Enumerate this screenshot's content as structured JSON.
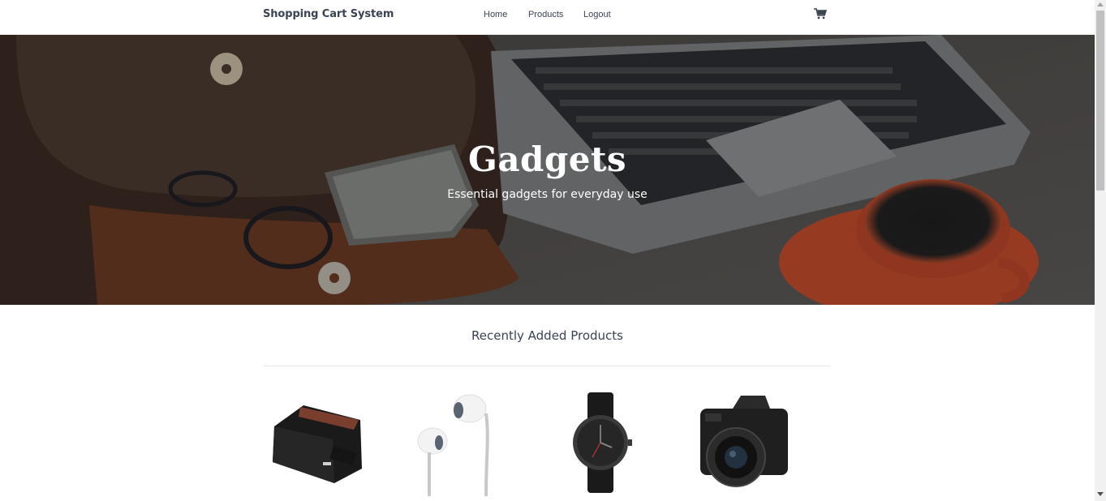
{
  "header": {
    "brand": "Shopping Cart System",
    "nav": [
      {
        "label": "Home"
      },
      {
        "label": "Products"
      },
      {
        "label": "Logout"
      }
    ],
    "cart_icon": "shopping-cart-icon"
  },
  "hero": {
    "title": "Gadgets",
    "subtitle": "Essential gadgets for everyday use"
  },
  "recent": {
    "title": "Recently Added Products",
    "products": [
      {
        "icon": "wallet-image"
      },
      {
        "icon": "headphones-image"
      },
      {
        "icon": "watch-image"
      },
      {
        "icon": "camera-image"
      }
    ]
  },
  "colors": {
    "text": "#394352",
    "hero_overlay": "#3c3a38"
  }
}
